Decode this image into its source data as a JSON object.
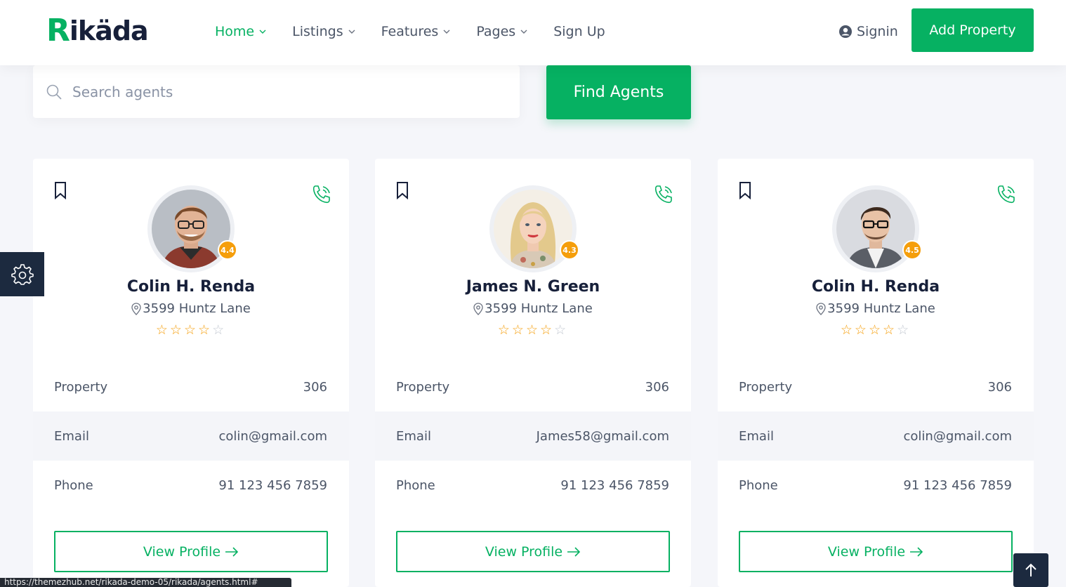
{
  "header": {
    "logo_first": "R",
    "logo_rest": "ikäda",
    "nav": [
      {
        "label": "Home",
        "active": true,
        "dropdown": true
      },
      {
        "label": "Listings",
        "active": false,
        "dropdown": true
      },
      {
        "label": "Features",
        "active": false,
        "dropdown": true
      },
      {
        "label": "Pages",
        "active": false,
        "dropdown": true
      },
      {
        "label": "Sign Up",
        "active": false,
        "dropdown": false
      }
    ],
    "signin_label": "Signin",
    "add_property_label": "Add Property"
  },
  "search": {
    "placeholder": "Search agents",
    "button_label": "Find Agents"
  },
  "agents": [
    {
      "name": "Colin H. Renda",
      "rating": "4.4",
      "address": "3599 Huntz Lane",
      "stars_filled": 4,
      "stars_total": 5,
      "property_label": "Property",
      "property_value": "306",
      "email_label": "Email",
      "email_value": "colin@gmail.com",
      "phone_label": "Phone",
      "phone_value": "91 123 456 7859",
      "button_label": "View Profile"
    },
    {
      "name": "James N. Green",
      "rating": "4.3",
      "address": "3599 Huntz Lane",
      "stars_filled": 4,
      "stars_total": 5,
      "property_label": "Property",
      "property_value": "306",
      "email_label": "Email",
      "email_value": "James58@gmail.com",
      "phone_label": "Phone",
      "phone_value": "91 123 456 7859",
      "button_label": "View Profile"
    },
    {
      "name": "Colin H. Renda",
      "rating": "4.5",
      "address": "3599 Huntz Lane",
      "stars_filled": 4,
      "stars_total": 5,
      "property_label": "Property",
      "property_value": "306",
      "email_label": "Email",
      "email_value": "colin@gmail.com",
      "phone_label": "Phone",
      "phone_value": "91 123 456 7859",
      "button_label": "View Profile"
    }
  ],
  "status_bar_url": "https://themezhub.net/rikada-demo-05/rikada/agents.html#",
  "colors": {
    "accent": "#06b162",
    "dark": "#17203a",
    "star": "#f59e0b",
    "floating": "#1c2a3f"
  },
  "icons": [
    "search-icon",
    "user-circle-icon",
    "chevron-down-icon",
    "bookmark-icon",
    "phone-icon",
    "map-pin-icon",
    "star-icon",
    "arrow-right-icon",
    "gear-icon",
    "arrow-up-icon"
  ]
}
